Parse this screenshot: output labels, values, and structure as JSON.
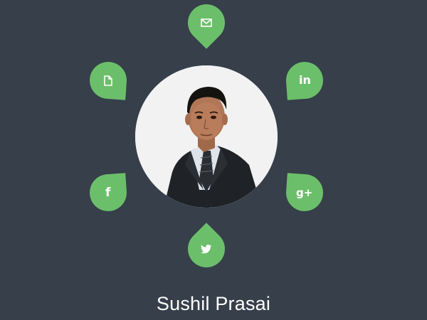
{
  "profile": {
    "name": "Sushil Prasai",
    "photo": "profile-photo"
  },
  "social": [
    {
      "id": "email",
      "icon": "envelope-icon"
    },
    {
      "id": "resume",
      "icon": "document-icon"
    },
    {
      "id": "linkedin",
      "icon": "linkedin-icon",
      "glyph": "in"
    },
    {
      "id": "facebook",
      "icon": "facebook-icon",
      "glyph": "f"
    },
    {
      "id": "googleplus",
      "icon": "google-plus-icon",
      "glyph": "g+"
    },
    {
      "id": "twitter",
      "icon": "twitter-icon"
    }
  ],
  "colors": {
    "background": "#363f4a",
    "accent": "#6cbf6a",
    "text": "#ffffff"
  }
}
